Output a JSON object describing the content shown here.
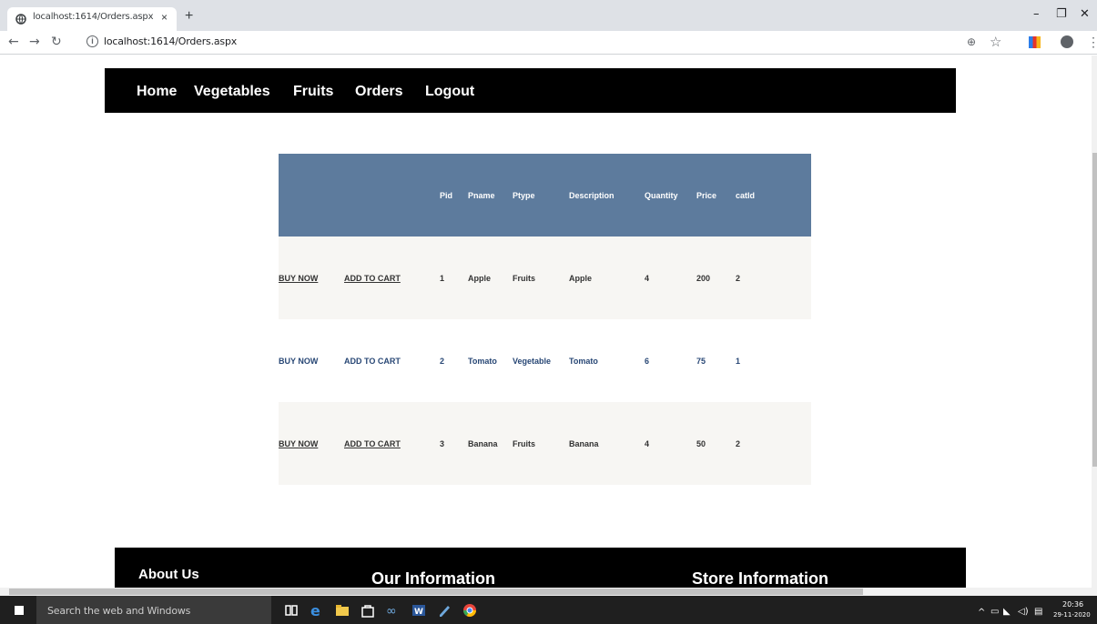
{
  "browser": {
    "tab_title": "localhost:1614/Orders.aspx",
    "tab_close": "×",
    "new_tab": "+",
    "url": "localhost:1614/Orders.aspx",
    "window_minimize": "–",
    "window_maximize": "❐",
    "window_close": "✕"
  },
  "site_nav": {
    "home": "Home",
    "vegetables": "Vegetables",
    "fruits": "Fruits",
    "orders": "Orders",
    "logout": "Logout"
  },
  "orders_table": {
    "headers": [
      "",
      "",
      "Pid",
      "Pname",
      "Ptype",
      "Description",
      "Quantity",
      "Price",
      "catId"
    ],
    "rows": [
      {
        "buy": "BUY NOW",
        "cart": "ADD TO CART",
        "pid": "1",
        "pname": "Apple",
        "ptype": "Fruits",
        "description": "Apple",
        "quantity": "4",
        "price": "200",
        "catid": "2"
      },
      {
        "buy": "BUY NOW",
        "cart": "ADD TO CART",
        "pid": "2",
        "pname": "Tomato",
        "ptype": "Vegetable",
        "description": "Tomato",
        "quantity": "6",
        "price": "75",
        "catid": "1"
      },
      {
        "buy": "BUY NOW",
        "cart": "ADD TO CART",
        "pid": "3",
        "pname": "Banana",
        "ptype": "Fruits",
        "description": "Banana",
        "quantity": "4",
        "price": "50",
        "catid": "2"
      }
    ]
  },
  "footer": {
    "about": "About Us",
    "our_info": "Our Information",
    "store_info": "Store Information"
  },
  "taskbar": {
    "search_placeholder": "Search the web and Windows",
    "time": "20:36",
    "date": "29-11-2020"
  },
  "colors": {
    "header_bg": "#5d7b9d",
    "alt_row_bg": "#f7f6f3",
    "nav_bg": "#000000"
  }
}
